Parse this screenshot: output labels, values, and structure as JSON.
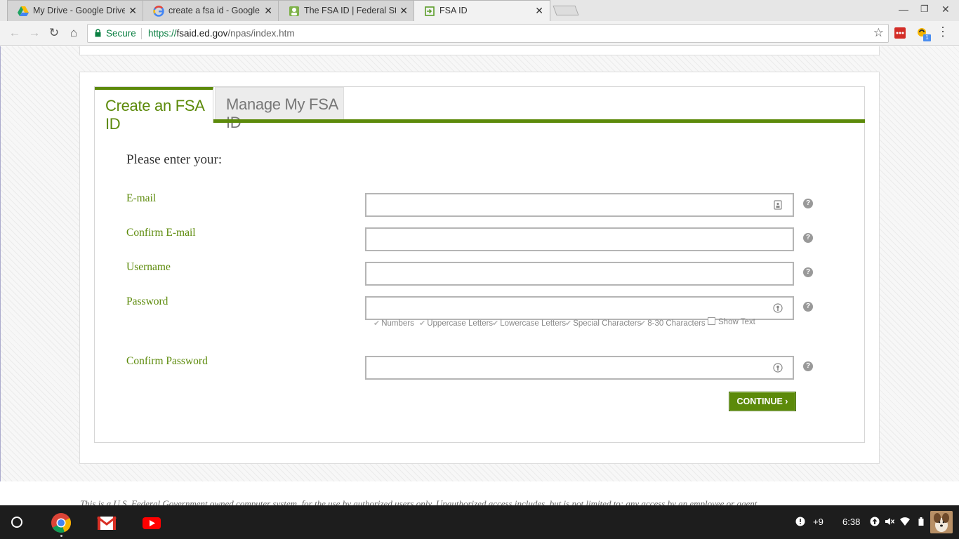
{
  "browser": {
    "tabs": [
      {
        "title": "My Drive - Google Drive",
        "icon": "google-drive-icon",
        "active": false
      },
      {
        "title": "create a fsa id - Google S",
        "icon": "google-icon",
        "active": false
      },
      {
        "title": "The FSA ID | Federal Stud",
        "icon": "fsa-site-icon",
        "active": false
      },
      {
        "title": "FSA ID",
        "icon": "fsa-id-icon",
        "active": true
      }
    ],
    "close_glyph": "✕",
    "security_label": "Secure",
    "url_protocol": "https://",
    "url_host": "fsaid.ed.gov",
    "url_path": "/npas/index.htm",
    "extension_badge": "1"
  },
  "form": {
    "tab_create": "Create an FSA ID",
    "tab_manage": "Manage My FSA ID",
    "heading": "Please enter your:",
    "fields": {
      "email": {
        "label": "E-mail",
        "value": ""
      },
      "confirm_email": {
        "label": "Confirm E-mail",
        "value": ""
      },
      "username": {
        "label": "Username",
        "value": ""
      },
      "password": {
        "label": "Password",
        "value": ""
      },
      "confirm_password": {
        "label": "Confirm Password",
        "value": ""
      }
    },
    "help_glyph": "?",
    "password_requirements": [
      "Numbers",
      "Uppercase Letters",
      "Lowercase Letters",
      "Special Characters",
      "8-30 Characters"
    ],
    "show_text_label": "Show Text",
    "continue_label": "CONTINUE ›"
  },
  "footer": {
    "disclaimer": "This is a U.S. Federal Government owned computer system, for the use by authorized users only. Unauthorized access includes, but is not limited to: any access by an employee or agent"
  },
  "shelf": {
    "apps": [
      "chrome-icon",
      "gmail-icon",
      "youtube-icon"
    ],
    "notification_count": "+9",
    "time": "6:38"
  },
  "colors": {
    "fsa_green": "#5c8a0a",
    "shelf_bg": "#1d1d1d",
    "secure_green": "#0b8043"
  }
}
